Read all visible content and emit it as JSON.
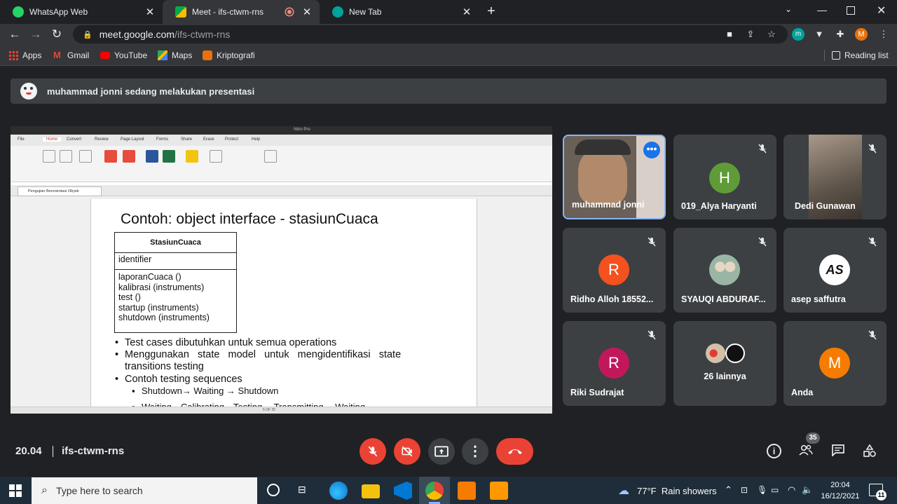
{
  "browser": {
    "tabs": [
      {
        "title": "WhatsApp Web",
        "favicon_color": "#25d366",
        "active": false
      },
      {
        "title": "Meet - ifs-ctwm-rns",
        "favicon_color": "#00897b",
        "active": true
      },
      {
        "title": "New Tab",
        "favicon_color": "#00a39b",
        "active": false
      }
    ],
    "url_host": "meet.google.com",
    "url_path": "/ifs-ctwm-rns",
    "profile_initial": "M",
    "bookmarks": [
      {
        "label": "Apps",
        "icon": "apps-grid-icon"
      },
      {
        "label": "Gmail",
        "icon": "gmail-icon"
      },
      {
        "label": "YouTube",
        "icon": "youtube-icon"
      },
      {
        "label": "Maps",
        "icon": "maps-icon"
      },
      {
        "label": "Kriptografi",
        "icon": "bookmark-site-icon"
      }
    ],
    "reading_list": "Reading list"
  },
  "meet": {
    "presenting_banner": "muhammad jonni sedang melakukan presentasi",
    "time": "20.04",
    "meeting_code": "ifs-ctwm-rns",
    "participant_count": "35",
    "participants": [
      {
        "name": "muhammad jonni",
        "avatar_letter": "",
        "color": "#5f6368",
        "muted": false,
        "video": true
      },
      {
        "name": "019_Alya Haryanti",
        "avatar_letter": "H",
        "color": "#5f9c38",
        "muted": true
      },
      {
        "name": "Dedi Gunawan",
        "avatar_letter": "",
        "color": "#6b5d52",
        "muted": true,
        "video": true
      },
      {
        "name": "Ridho Alloh 18552...",
        "avatar_letter": "R",
        "color": "#f4511e",
        "muted": true
      },
      {
        "name": "SYAUQI ABDURAF...",
        "avatar_letter": "",
        "color": "#9ab5a4",
        "muted": true
      },
      {
        "name": "asep saffutra",
        "avatar_letter": "",
        "color": "#ffffff",
        "muted": true
      },
      {
        "name": "Riki Sudrajat",
        "avatar_letter": "R",
        "color": "#c2185b",
        "muted": true
      },
      {
        "name": "26 lainnya",
        "avatar_letter": "",
        "color": "#3c4043",
        "muted": false
      },
      {
        "name": "Anda",
        "avatar_letter": "M",
        "color": "#f57c00",
        "muted": true
      }
    ]
  },
  "presentation": {
    "app_title": "Nitro Pro",
    "ribbon_tabs": [
      "File",
      "Home",
      "Convert",
      "Review",
      "Page Layout",
      "Forms",
      "Share",
      "Erase",
      "Protect",
      "Help"
    ],
    "doc_tab": "Pengujian Berorientasi Obyek",
    "slide_title": "Contoh: object interface - stasiunCuaca",
    "class_name": "StasiunCuaca",
    "attribute": "identifier",
    "operations": [
      "laporanCuaca ()",
      "kalibrasi (instruments)",
      "test ()",
      "startup (instruments)",
      "shutdown (instruments)"
    ],
    "bullets": [
      "Test cases dibutuhkan untuk semua operations",
      "Menggunakan   state   model   untuk   mengidentifikasi   state",
      "transitions testing",
      "Contoh testing sequences"
    ],
    "sub_bullets": [
      "Shutdown→ Waiting → Shutdown",
      "Waiting→Calibrating→Testing→ Transmitting →Waiting"
    ],
    "page_indicator": "5 OF 25"
  },
  "taskbar": {
    "search_placeholder": "Type here to search",
    "weather": "77°F  Rain showers",
    "time": "20:04",
    "date": "16/12/2021",
    "notifications": "11"
  }
}
